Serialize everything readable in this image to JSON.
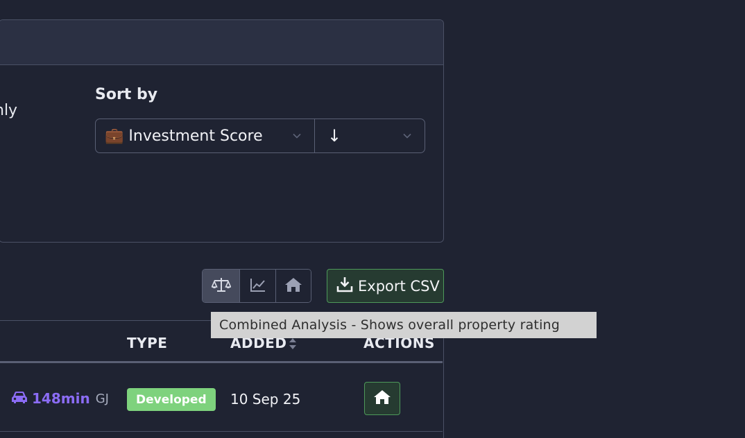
{
  "filters": {
    "only_label_fragment": "nly",
    "sort_label": "Sort by",
    "sort_field": {
      "icon": "briefcase-icon",
      "value": "💼 Investment Score"
    },
    "sort_direction": {
      "value": "↓"
    }
  },
  "toolbar": {
    "views": [
      {
        "name": "combined-analysis",
        "icon": "scale-icon",
        "active": true
      },
      {
        "name": "market-trends",
        "icon": "line-chart-icon",
        "active": false
      },
      {
        "name": "property-view",
        "icon": "home-icon",
        "active": false
      }
    ],
    "export_label": "Export CSV",
    "tooltip": "Combined Analysis - Shows overall property rating"
  },
  "table": {
    "headers": {
      "type": "TYPE",
      "added": "ADDED",
      "actions": "ACTIONS"
    },
    "rows": [
      {
        "drive_time": "148min",
        "drive_code": "GJ",
        "type": "Developed",
        "added": "10 Sep 25"
      }
    ]
  },
  "colors": {
    "background": "#1f2332",
    "panel_header": "#2b3043",
    "accent_purple": "#8b6cf5",
    "success_green": "#7ed27d",
    "export_border": "#4e9a5a"
  }
}
